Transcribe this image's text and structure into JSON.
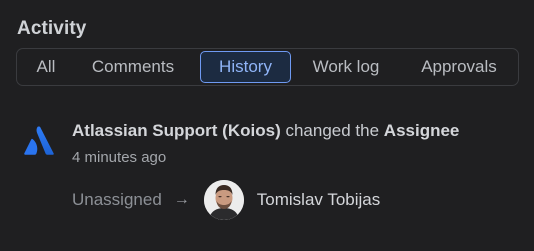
{
  "section": {
    "title": "Activity"
  },
  "tabs": [
    {
      "label": "All",
      "active": false
    },
    {
      "label": "Comments",
      "active": false
    },
    {
      "label": "History",
      "active": true
    },
    {
      "label": "Work log",
      "active": false
    },
    {
      "label": "Approvals",
      "active": false
    }
  ],
  "event": {
    "actor": "Atlassian Support (Koios)",
    "action": "changed the",
    "field": "Assignee",
    "time": "4 minutes ago",
    "from_value": "Unassigned",
    "arrow": "→",
    "to_value": "Tomislav Tobijas",
    "logo_icon": "atlassian-logo-icon"
  },
  "colors": {
    "background": "#1f1f21",
    "active_tab_border": "#6f9af2",
    "active_tab_text": "#8fb4f7",
    "atlassian_blue": "#2f7cf6"
  }
}
